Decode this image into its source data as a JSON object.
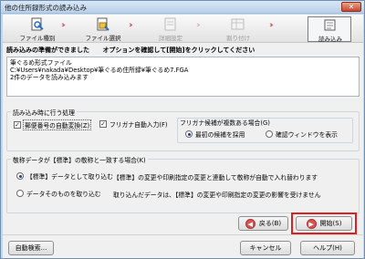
{
  "window": {
    "title": "他の住所録形式の読み込み",
    "close_glyph": "✕"
  },
  "steps": [
    {
      "label": "ファイル種別",
      "icon": "file-type-icon"
    },
    {
      "label": "ファイル選択",
      "icon": "file-select-icon"
    },
    {
      "label": "詳細設定",
      "icon": "detail-settings-icon"
    },
    {
      "label": "割り付け",
      "icon": "assign-icon"
    },
    {
      "label": "読み込み",
      "icon": "import-icon"
    }
  ],
  "step_arrow": "›››",
  "header": {
    "ready": "読み込みの準備ができました",
    "instruction": "オプションを確認して[開始]をクリックしてください"
  },
  "info": {
    "line1": "筆ぐるめ形式ファイル",
    "line2": "C:¥Users¥nakada¥Desktop¥筆ぐるめ住所録¥筆ぐるめ7.FGA",
    "line3": "2件のデータを読み込みます"
  },
  "import_options": {
    "title": "読み込み時に行う処理",
    "postal_check": "郵便番号の自動変換(Z)",
    "furigana_check": "フリガナ自動入力(F)",
    "furigana_group_title": "フリガナ候補が複数ある場合(G)",
    "radio_first": "最初の候補を採用",
    "radio_confirm": "確認ウィンドウを表示"
  },
  "honorific": {
    "title": "敬称データが【標準】の敬称と一致する場合(K)",
    "radio_standard": "【標準】データとして取り込む",
    "radio_asis": "データそのものを取り込む",
    "desc_standard": "【標準】の変更や印刷指定の変更と連動して敬称が自動で入れ替わります",
    "desc_asis": "取り込んだデータは、【標準】の変更や印刷指定の変更の影響を受けません"
  },
  "buttons": {
    "back": "戻る(B)",
    "start": "開始(S)",
    "auto_search": "自動検索...",
    "cancel": "キャンセル",
    "help": "ヘルプ(H)"
  }
}
